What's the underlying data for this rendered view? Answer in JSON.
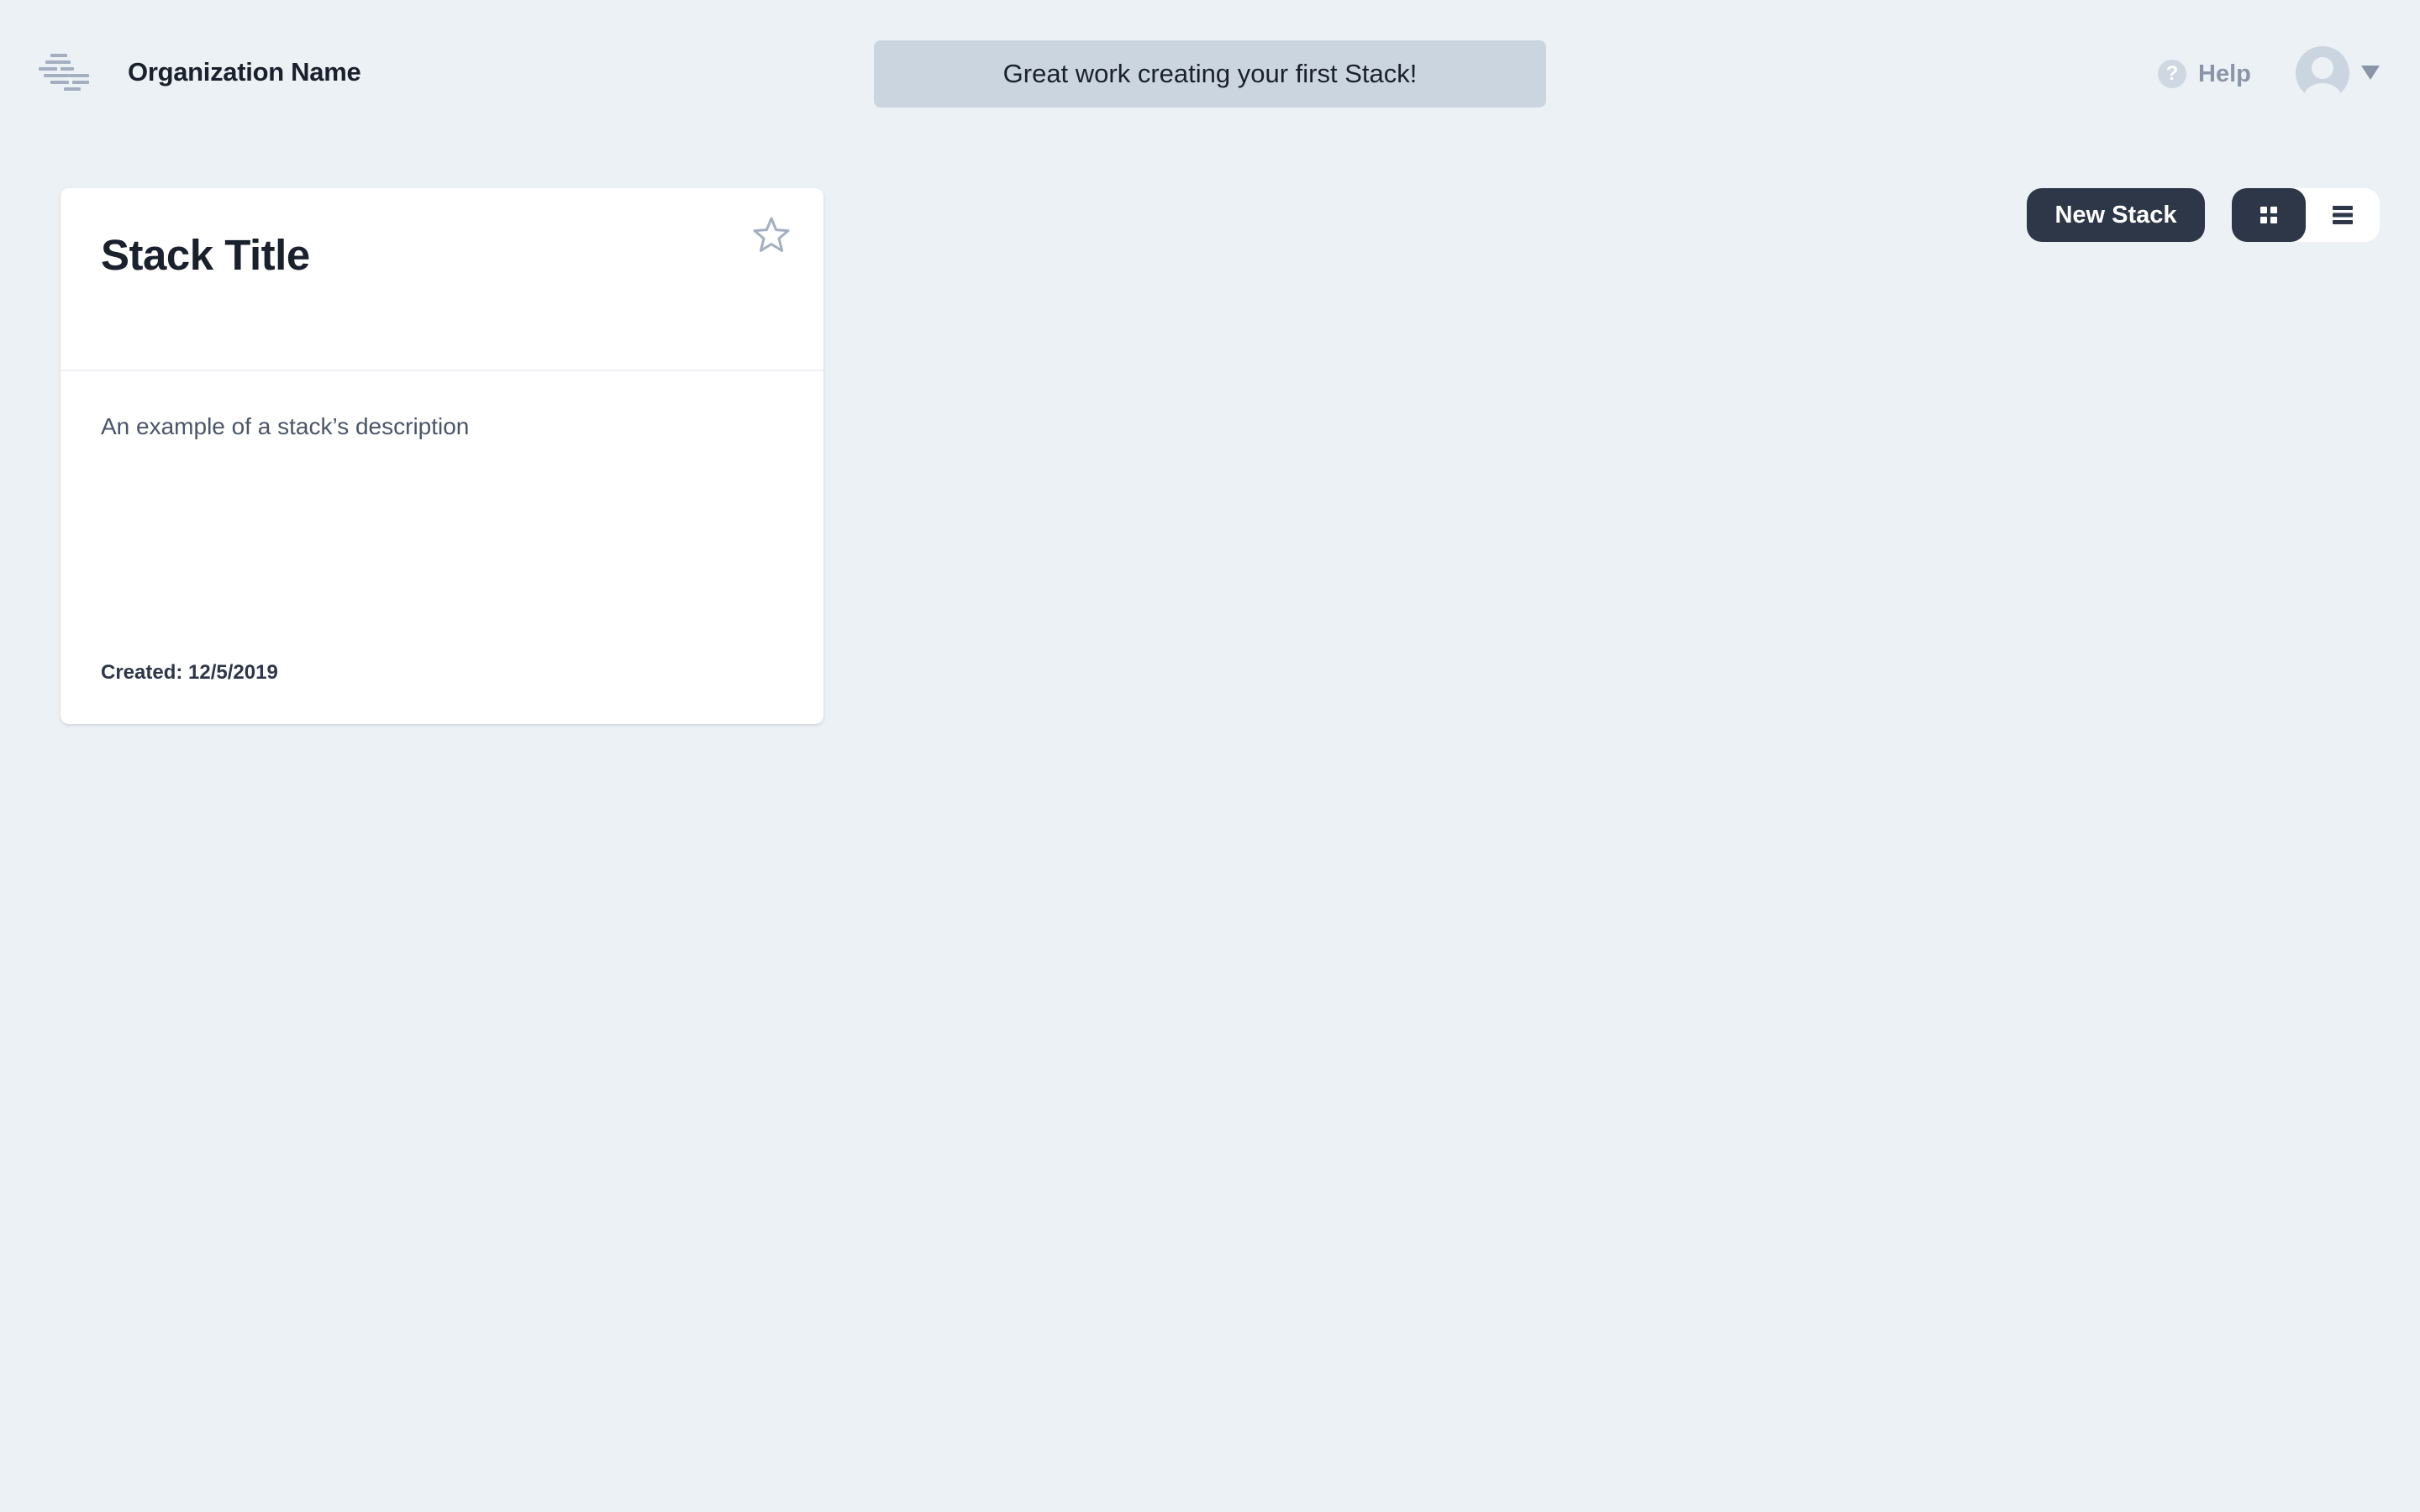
{
  "header": {
    "org_name": "Organization Name",
    "notice": "Great work creating your first Stack!",
    "help_label": "Help",
    "help_icon_glyph": "?"
  },
  "toolbar": {
    "new_stack_label": "New Stack",
    "views": [
      {
        "name": "grid-view",
        "icon": "grid-icon",
        "active": true
      },
      {
        "name": "list-view",
        "icon": "list-icon",
        "active": false
      }
    ]
  },
  "stacks": [
    {
      "title": "Stack Title",
      "description": "An example of a stack’s description",
      "created": "Created: 12/5/2019",
      "starred": false
    }
  ],
  "colors": {
    "background": "#ecf1f6",
    "primary_dark": "#2d3748",
    "notice_bg": "#cbd5e0",
    "muted": "#8a96a8"
  }
}
